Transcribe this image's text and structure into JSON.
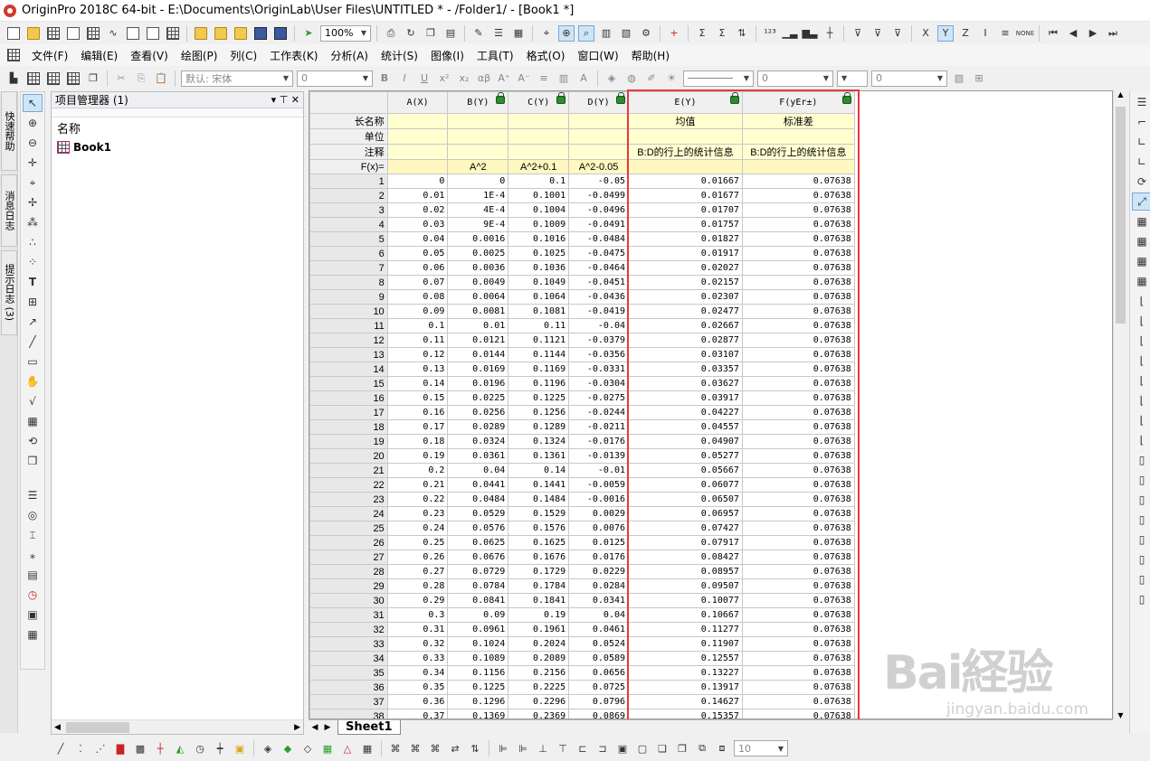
{
  "window": {
    "title": "OriginPro 2018C 64-bit - E:\\Documents\\OriginLab\\User Files\\UNTITLED * - /Folder1/ - [Book1 *]"
  },
  "toolbar": {
    "zoom": "100%",
    "font_name": "默认: 宋体",
    "font_size": "0",
    "field_a": "0",
    "field_b": "0",
    "bottom_size": "10"
  },
  "menu": [
    {
      "label": "文件(F)"
    },
    {
      "label": "编辑(E)"
    },
    {
      "label": "查看(V)"
    },
    {
      "label": "绘图(P)"
    },
    {
      "label": "列(C)"
    },
    {
      "label": "工作表(K)"
    },
    {
      "label": "分析(A)"
    },
    {
      "label": "统计(S)"
    },
    {
      "label": "图像(I)"
    },
    {
      "label": "工具(T)"
    },
    {
      "label": "格式(O)"
    },
    {
      "label": "窗口(W)"
    },
    {
      "label": "帮助(H)"
    }
  ],
  "dock_tabs": {
    "quick_help": "快速帮助",
    "message_log": "消息日志",
    "hint_log": "提示日志 (3)"
  },
  "project_manager": {
    "title": "项目管理器 (1)",
    "name_header": "名称",
    "book": "Book1"
  },
  "worksheet": {
    "columns": [
      {
        "name": "A(X)",
        "long": "",
        "unit": "",
        "comment": "",
        "fx": ""
      },
      {
        "name": "B(Y)",
        "long": "",
        "unit": "",
        "comment": "",
        "fx": "A^2"
      },
      {
        "name": "C(Y)",
        "long": "",
        "unit": "",
        "comment": "",
        "fx": "A^2+0.1"
      },
      {
        "name": "D(Y)",
        "long": "",
        "unit": "",
        "comment": "",
        "fx": "A^2-0.05"
      },
      {
        "name": "E(Y)",
        "long": "均值",
        "unit": "",
        "comment": "B:D的行上的统计信息",
        "fx": ""
      },
      {
        "name": "F(yEr±)",
        "long": "标准差",
        "unit": "",
        "comment": "B:D的行上的统计信息",
        "fx": ""
      }
    ],
    "meta_labels": [
      "长名称",
      "单位",
      "注释",
      "F(x)="
    ],
    "rows": [
      [
        "1",
        "0",
        "0",
        "0.1",
        "-0.05",
        "0.01667",
        "0.07638"
      ],
      [
        "2",
        "0.01",
        "1E-4",
        "0.1001",
        "-0.0499",
        "0.01677",
        "0.07638"
      ],
      [
        "3",
        "0.02",
        "4E-4",
        "0.1004",
        "-0.0496",
        "0.01707",
        "0.07638"
      ],
      [
        "4",
        "0.03",
        "9E-4",
        "0.1009",
        "-0.0491",
        "0.01757",
        "0.07638"
      ],
      [
        "5",
        "0.04",
        "0.0016",
        "0.1016",
        "-0.0484",
        "0.01827",
        "0.07638"
      ],
      [
        "6",
        "0.05",
        "0.0025",
        "0.1025",
        "-0.0475",
        "0.01917",
        "0.07638"
      ],
      [
        "7",
        "0.06",
        "0.0036",
        "0.1036",
        "-0.0464",
        "0.02027",
        "0.07638"
      ],
      [
        "8",
        "0.07",
        "0.0049",
        "0.1049",
        "-0.0451",
        "0.02157",
        "0.07638"
      ],
      [
        "9",
        "0.08",
        "0.0064",
        "0.1064",
        "-0.0436",
        "0.02307",
        "0.07638"
      ],
      [
        "10",
        "0.09",
        "0.0081",
        "0.1081",
        "-0.0419",
        "0.02477",
        "0.07638"
      ],
      [
        "11",
        "0.1",
        "0.01",
        "0.11",
        "-0.04",
        "0.02667",
        "0.07638"
      ],
      [
        "12",
        "0.11",
        "0.0121",
        "0.1121",
        "-0.0379",
        "0.02877",
        "0.07638"
      ],
      [
        "13",
        "0.12",
        "0.0144",
        "0.1144",
        "-0.0356",
        "0.03107",
        "0.07638"
      ],
      [
        "14",
        "0.13",
        "0.0169",
        "0.1169",
        "-0.0331",
        "0.03357",
        "0.07638"
      ],
      [
        "15",
        "0.14",
        "0.0196",
        "0.1196",
        "-0.0304",
        "0.03627",
        "0.07638"
      ],
      [
        "16",
        "0.15",
        "0.0225",
        "0.1225",
        "-0.0275",
        "0.03917",
        "0.07638"
      ],
      [
        "17",
        "0.16",
        "0.0256",
        "0.1256",
        "-0.0244",
        "0.04227",
        "0.07638"
      ],
      [
        "18",
        "0.17",
        "0.0289",
        "0.1289",
        "-0.0211",
        "0.04557",
        "0.07638"
      ],
      [
        "19",
        "0.18",
        "0.0324",
        "0.1324",
        "-0.0176",
        "0.04907",
        "0.07638"
      ],
      [
        "20",
        "0.19",
        "0.0361",
        "0.1361",
        "-0.0139",
        "0.05277",
        "0.07638"
      ],
      [
        "21",
        "0.2",
        "0.04",
        "0.14",
        "-0.01",
        "0.05667",
        "0.07638"
      ],
      [
        "22",
        "0.21",
        "0.0441",
        "0.1441",
        "-0.0059",
        "0.06077",
        "0.07638"
      ],
      [
        "23",
        "0.22",
        "0.0484",
        "0.1484",
        "-0.0016",
        "0.06507",
        "0.07638"
      ],
      [
        "24",
        "0.23",
        "0.0529",
        "0.1529",
        "0.0029",
        "0.06957",
        "0.07638"
      ],
      [
        "25",
        "0.24",
        "0.0576",
        "0.1576",
        "0.0076",
        "0.07427",
        "0.07638"
      ],
      [
        "26",
        "0.25",
        "0.0625",
        "0.1625",
        "0.0125",
        "0.07917",
        "0.07638"
      ],
      [
        "27",
        "0.26",
        "0.0676",
        "0.1676",
        "0.0176",
        "0.08427",
        "0.07638"
      ],
      [
        "28",
        "0.27",
        "0.0729",
        "0.1729",
        "0.0229",
        "0.08957",
        "0.07638"
      ],
      [
        "29",
        "0.28",
        "0.0784",
        "0.1784",
        "0.0284",
        "0.09507",
        "0.07638"
      ],
      [
        "30",
        "0.29",
        "0.0841",
        "0.1841",
        "0.0341",
        "0.10077",
        "0.07638"
      ],
      [
        "31",
        "0.3",
        "0.09",
        "0.19",
        "0.04",
        "0.10667",
        "0.07638"
      ],
      [
        "32",
        "0.31",
        "0.0961",
        "0.1961",
        "0.0461",
        "0.11277",
        "0.07638"
      ],
      [
        "33",
        "0.32",
        "0.1024",
        "0.2024",
        "0.0524",
        "0.11907",
        "0.07638"
      ],
      [
        "34",
        "0.33",
        "0.1089",
        "0.2089",
        "0.0589",
        "0.12557",
        "0.07638"
      ],
      [
        "35",
        "0.34",
        "0.1156",
        "0.2156",
        "0.0656",
        "0.13227",
        "0.07638"
      ],
      [
        "36",
        "0.35",
        "0.1225",
        "0.2225",
        "0.0725",
        "0.13917",
        "0.07638"
      ],
      [
        "37",
        "0.36",
        "0.1296",
        "0.2296",
        "0.0796",
        "0.14627",
        "0.07638"
      ],
      [
        "38",
        "0.37",
        "0.1369",
        "0.2369",
        "0.0869",
        "0.15357",
        "0.07638"
      ]
    ]
  },
  "sheet_tabs": [
    {
      "label": "Sheet1"
    }
  ],
  "watermark": {
    "brand": "Bai経验",
    "url": "jingyan.baidu.com"
  },
  "colors": {
    "highlight_box": "#e6393f",
    "meta_bg": "#ffffd0",
    "lock": "#2e8b2e"
  }
}
